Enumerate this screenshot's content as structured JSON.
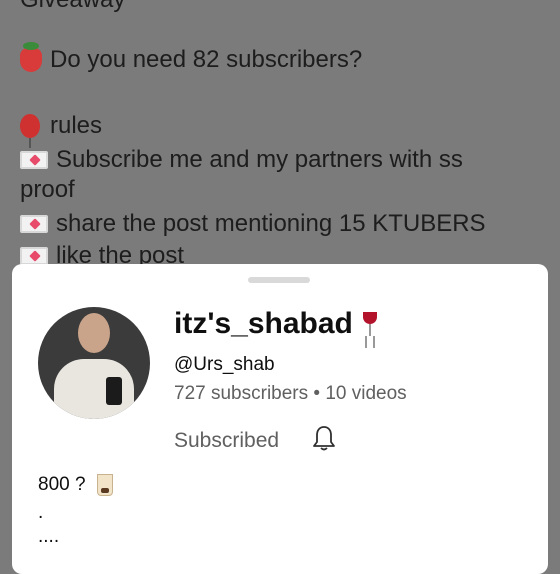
{
  "post": {
    "lines": [
      "Giveaway",
      "Do you need 82 subscribers?",
      "rules",
      "Subscribe me and my partners with ss",
      "proof",
      "share the post mentioning 15 KTUBERS",
      "like the post"
    ]
  },
  "sheet": {
    "channel_name": "itz's_shabad",
    "handle": "@Urs_shab",
    "stats": "727 subscribers • 10 videos",
    "subscribed_label": "Subscribed",
    "description": [
      "800 ?",
      ".",
      "...."
    ]
  },
  "icons": [
    "cherry-icon",
    "strawberry-icon",
    "balloon-icon",
    "love-letter-icon",
    "wine-glass-icon",
    "bell-icon",
    "bubble-tea-icon"
  ],
  "colors": {
    "overlay_bg": "#7b7b7b",
    "sheet_bg": "#ffffff",
    "accent_red": "#b31c2c"
  }
}
